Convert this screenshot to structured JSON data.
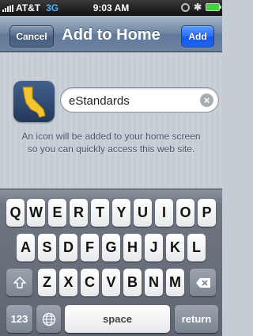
{
  "status_bar": {
    "carrier": "AT&T",
    "network": "3G",
    "time": "9:03 AM"
  },
  "nav": {
    "cancel_label": "Cancel",
    "title": "Add to Home",
    "add_label": "Add"
  },
  "content": {
    "name_value": "eStandards",
    "hint_line1": "An icon will be added to your home screen",
    "hint_line2": "so you can quickly access this web site."
  },
  "keyboard": {
    "row1": [
      "Q",
      "W",
      "E",
      "R",
      "T",
      "Y",
      "U",
      "I",
      "O",
      "P"
    ],
    "row2": [
      "A",
      "S",
      "D",
      "F",
      "G",
      "H",
      "J",
      "K",
      "L"
    ],
    "row3": [
      "Z",
      "X",
      "C",
      "V",
      "B",
      "N",
      "M"
    ],
    "numbers_label": "123",
    "space_label": "space",
    "return_label": "return"
  },
  "icons": {
    "shift": "shift-icon",
    "backspace": "backspace-icon",
    "globe": "globe-icon",
    "clear": "clear-icon",
    "app": "california-map-icon"
  }
}
